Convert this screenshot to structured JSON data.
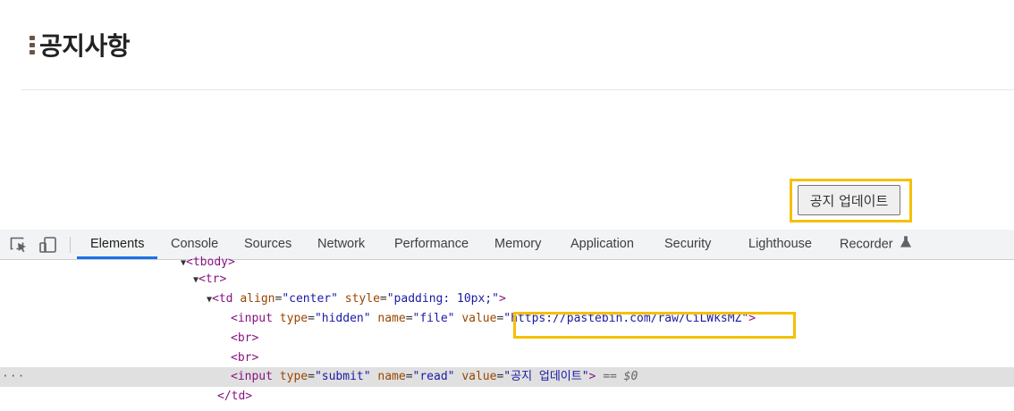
{
  "page": {
    "title": "공지사항",
    "submit_button_label": "공지 업데이트"
  },
  "devtools": {
    "tabs": [
      "Elements",
      "Console",
      "Sources",
      "Network",
      "Performance",
      "Memory",
      "Application",
      "Security",
      "Lighthouse",
      "Recorder"
    ],
    "active_tab": "Elements",
    "recorder_icon": "flask-icon",
    "dom_lines": {
      "tbody": "<tbody>",
      "tr": "<tr>",
      "td_tag": "<td",
      "td_attr1_name": "align",
      "td_attr1_value": "\"center\"",
      "td_attr2_name": "style",
      "td_attr2_value": "\"padding: 10px;\"",
      "td_close": ">",
      "input_tag": "<input",
      "type_name": "type",
      "hidden_value": "\"hidden\"",
      "name_name": "name",
      "file_value": "\"file\"",
      "value_name": "value",
      "url_value": "\"https://pastebin.com/raw/CiLWksMZ\"",
      "br": "<br>",
      "submit_value": "\"submit\"",
      "read_value": "\"read\"",
      "label_value": "\"공지 업데이트\"",
      "eq_marker": "== $0",
      "td_end": "</td>",
      "gt": ">"
    }
  },
  "colors": {
    "highlight": "#f5c000",
    "active_tab_underline": "#1a73e8",
    "tag": "#881280",
    "attr_name": "#994500",
    "attr_value": "#1a1aa6"
  }
}
